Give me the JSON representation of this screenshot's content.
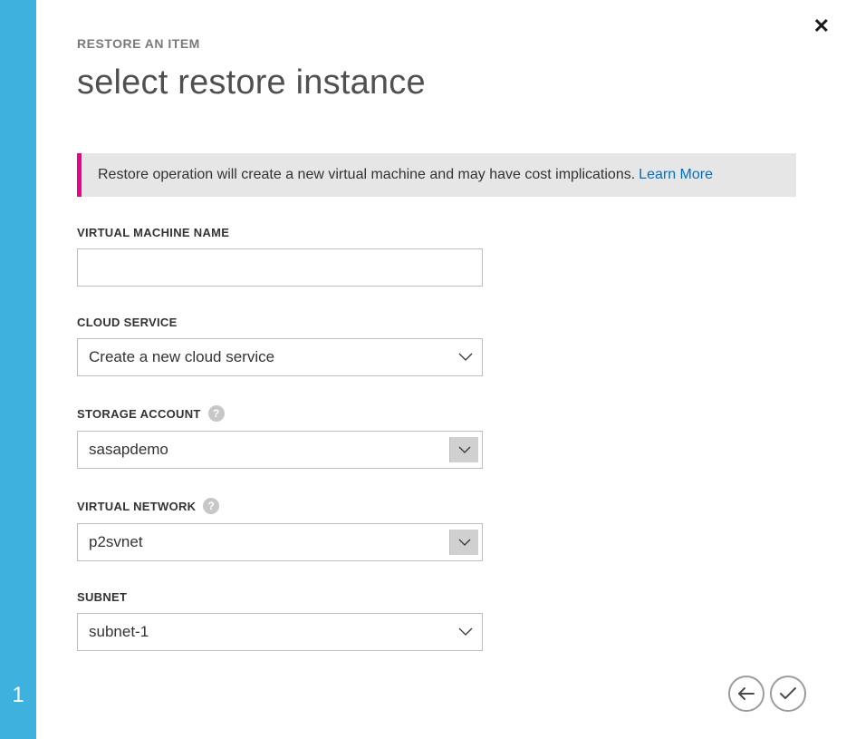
{
  "step": "1",
  "breadcrumb": "RESTORE AN ITEM",
  "title": "select restore instance",
  "banner": {
    "text": "Restore operation will create a new virtual machine and may have cost implications.",
    "link": "Learn More"
  },
  "fields": {
    "vm_name": {
      "label": "VIRTUAL MACHINE NAME",
      "value": ""
    },
    "cloud_service": {
      "label": "CLOUD SERVICE",
      "value": "Create a new cloud service"
    },
    "storage_account": {
      "label": "STORAGE ACCOUNT",
      "value": "sasapdemo"
    },
    "virtual_network": {
      "label": "VIRTUAL NETWORK",
      "value": "p2svnet"
    },
    "subnet": {
      "label": "SUBNET",
      "value": "subnet-1"
    }
  }
}
